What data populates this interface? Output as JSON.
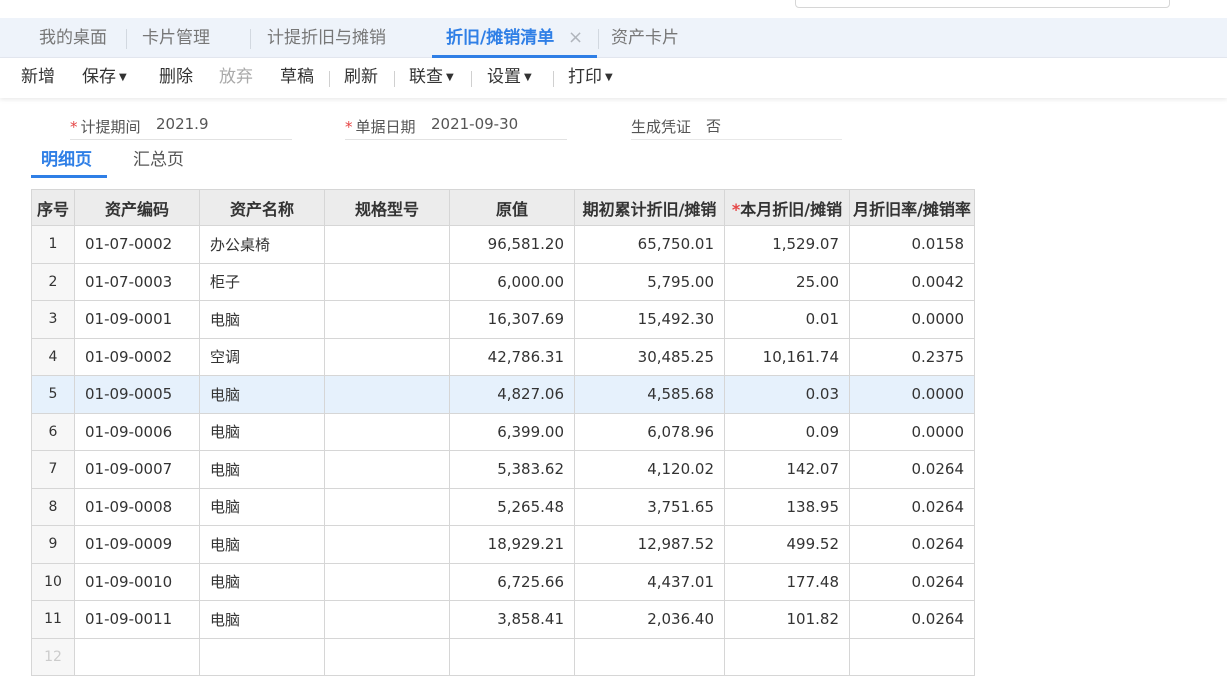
{
  "tabs": [
    {
      "label": "我的桌面"
    },
    {
      "label": "卡片管理"
    },
    {
      "label": "计提折旧与摊销"
    },
    {
      "label": "折旧/摊销清单",
      "active": true
    },
    {
      "label": "资产卡片"
    }
  ],
  "toolbar": {
    "new": "新增",
    "save": "保存",
    "delete": "删除",
    "discard": "放弃",
    "draft": "草稿",
    "refresh": "刷新",
    "link": "联查",
    "settings": "设置",
    "print": "打印"
  },
  "form": {
    "period_label": "计提期间",
    "period_value": "2021.9",
    "date_label": "单据日期",
    "date_value": "2021-09-30",
    "voucher_label": "生成凭证",
    "voucher_value": "否"
  },
  "subtabs": {
    "detail": "明细页",
    "summary": "汇总页"
  },
  "table": {
    "headers": [
      "序号",
      "资产编码",
      "资产名称",
      "规格型号",
      "原值",
      "期初累计折旧/摊销",
      "本月折旧/摊销",
      "月折旧率/摊销率"
    ],
    "rows": [
      [
        "1",
        "01-07-0002",
        "办公桌椅",
        "",
        "96,581.20",
        "65,750.01",
        "1,529.07",
        "0.0158"
      ],
      [
        "2",
        "01-07-0003",
        "柜子",
        "",
        "6,000.00",
        "5,795.00",
        "25.00",
        "0.0042"
      ],
      [
        "3",
        "01-09-0001",
        "电脑",
        "",
        "16,307.69",
        "15,492.30",
        "0.01",
        "0.0000"
      ],
      [
        "4",
        "01-09-0002",
        "空调",
        "",
        "42,786.31",
        "30,485.25",
        "10,161.74",
        "0.2375"
      ],
      [
        "5",
        "01-09-0005",
        "电脑",
        "",
        "4,827.06",
        "4,585.68",
        "0.03",
        "0.0000"
      ],
      [
        "6",
        "01-09-0006",
        "电脑",
        "",
        "6,399.00",
        "6,078.96",
        "0.09",
        "0.0000"
      ],
      [
        "7",
        "01-09-0007",
        "电脑",
        "",
        "5,383.62",
        "4,120.02",
        "142.07",
        "0.0264"
      ],
      [
        "8",
        "01-09-0008",
        "电脑",
        "",
        "5,265.48",
        "3,751.65",
        "138.95",
        "0.0264"
      ],
      [
        "9",
        "01-09-0009",
        "电脑",
        "",
        "18,929.21",
        "12,987.52",
        "499.52",
        "0.0264"
      ],
      [
        "10",
        "01-09-0010",
        "电脑",
        "",
        "6,725.66",
        "4,437.01",
        "177.48",
        "0.0264"
      ],
      [
        "11",
        "01-09-0011",
        "电脑",
        "",
        "3,858.41",
        "2,036.40",
        "101.82",
        "0.0264"
      ],
      [
        "12",
        "",
        "",
        "",
        "",
        "",
        "",
        ""
      ]
    ],
    "selected_row": 5
  },
  "colors": {
    "accent": "#2f7fe6",
    "required": "#e54545",
    "selected_row": "#e6f1fc"
  }
}
